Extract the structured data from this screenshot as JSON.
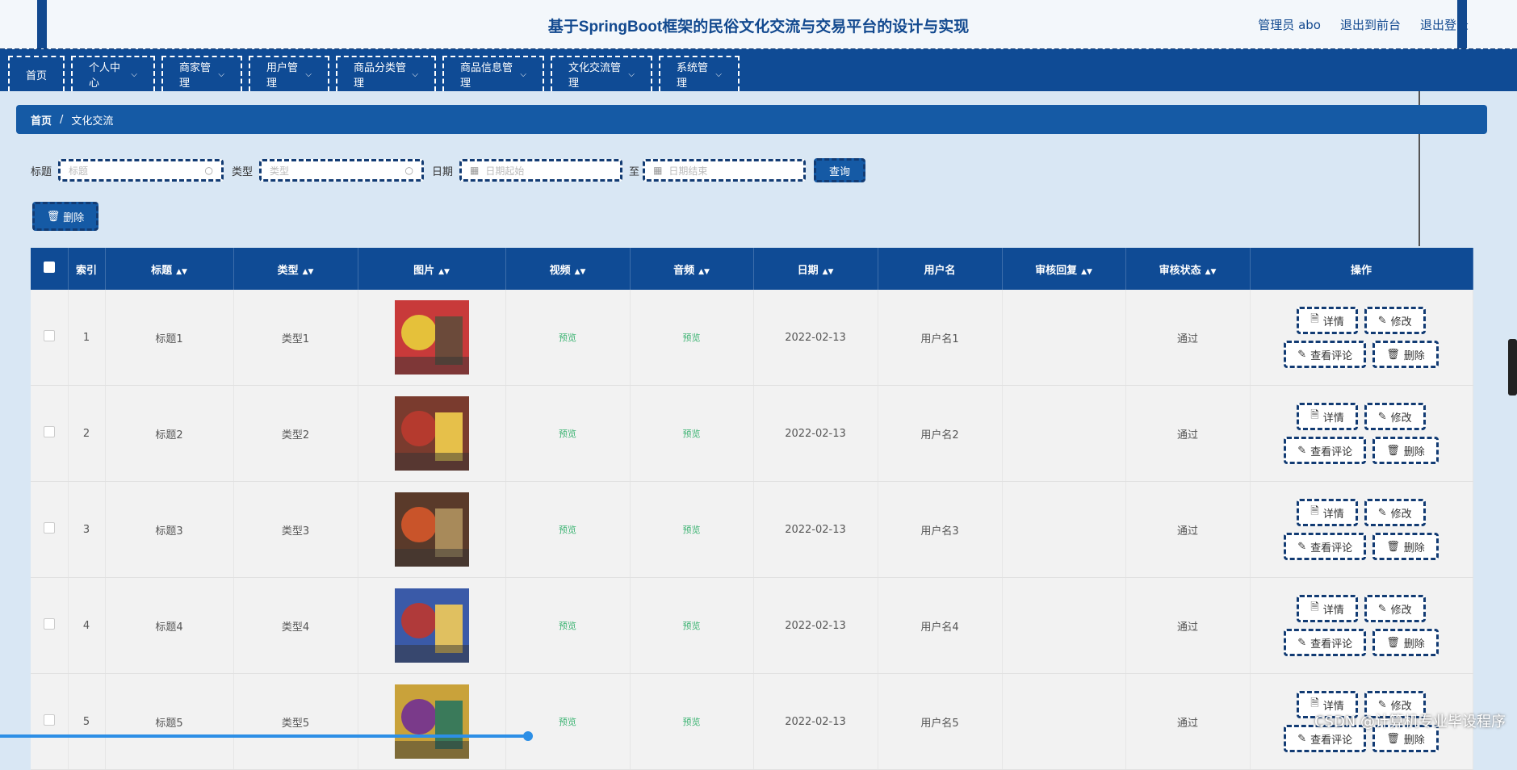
{
  "header": {
    "title": "基于SpringBoot框架的民俗文化交流与交易平台的设计与实现",
    "user": "管理员 abo",
    "to_front": "退出到前台",
    "logout": "退出登录"
  },
  "nav": [
    {
      "label": "首页"
    },
    {
      "label": "个人中心"
    },
    {
      "label": "商家管理"
    },
    {
      "label": "用户管理"
    },
    {
      "label": "商品分类管理"
    },
    {
      "label": "商品信息管理"
    },
    {
      "label": "文化交流管理"
    },
    {
      "label": "系统管理"
    }
  ],
  "breadcrumb": {
    "home": "首页",
    "sep": "/",
    "current": "文化交流"
  },
  "filters": {
    "title_label": "标题",
    "title_placeholder": "标题",
    "type_label": "类型",
    "type_placeholder": "类型",
    "date_label": "日期",
    "date_start": "日期起始",
    "to": "至",
    "date_end": "日期结束",
    "query": "查询"
  },
  "delete_button": "删除",
  "table": {
    "headers": [
      "索引",
      "标题",
      "类型",
      "图片",
      "视频",
      "音频",
      "日期",
      "用户名",
      "审核回复",
      "审核状态",
      "操作"
    ],
    "rows": [
      {
        "idx": "1",
        "title": "标题1",
        "type": "类型1",
        "video": "预览",
        "audio": "预览",
        "date": "2022-02-13",
        "user": "用户名1",
        "reply": "",
        "status": "通过"
      },
      {
        "idx": "2",
        "title": "标题2",
        "type": "类型2",
        "video": "预览",
        "audio": "预览",
        "date": "2022-02-13",
        "user": "用户名2",
        "reply": "",
        "status": "通过"
      },
      {
        "idx": "3",
        "title": "标题3",
        "type": "类型3",
        "video": "预览",
        "audio": "预览",
        "date": "2022-02-13",
        "user": "用户名3",
        "reply": "",
        "status": "通过"
      },
      {
        "idx": "4",
        "title": "标题4",
        "type": "类型4",
        "video": "预览",
        "audio": "预览",
        "date": "2022-02-13",
        "user": "用户名4",
        "reply": "",
        "status": "通过"
      },
      {
        "idx": "5",
        "title": "标题5",
        "type": "类型5",
        "video": "预览",
        "audio": "预览",
        "date": "2022-02-13",
        "user": "用户名5",
        "reply": "",
        "status": "通过"
      }
    ],
    "actions": {
      "detail": "详情",
      "edit": "修改",
      "comments": "查看评论",
      "delete": "删除"
    }
  },
  "watermark": "CSDN @计算机专业毕设程序",
  "colors": {
    "primary": "#0f4b95",
    "accent": "#155aa5",
    "preview": "#3cb372"
  },
  "icons": [
    "search-icon",
    "calendar-icon",
    "trash-icon",
    "document-icon",
    "edit-icon",
    "sort-icon",
    "chevron-down-icon"
  ]
}
